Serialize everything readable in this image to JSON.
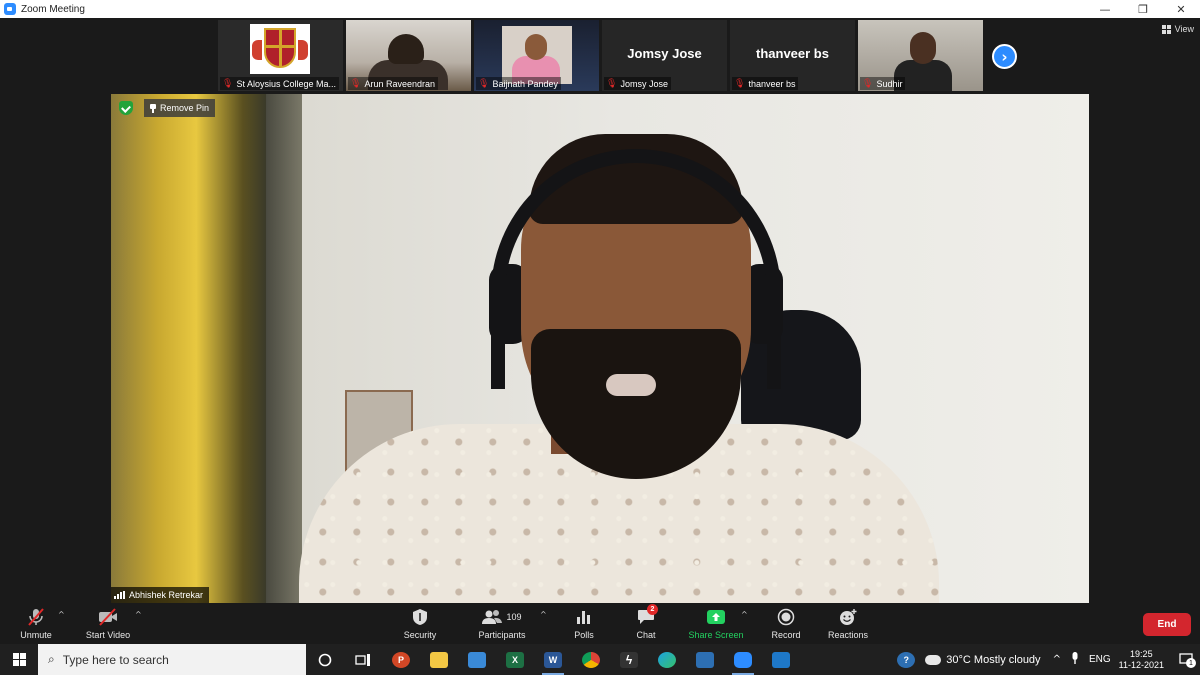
{
  "window": {
    "title": "Zoom Meeting",
    "minimize": "—",
    "restore": "❐",
    "close": "✕"
  },
  "view_label": "View",
  "participants_strip": [
    {
      "name": "St Aloysius College Ma..."
    },
    {
      "name": "Arun Raveendran"
    },
    {
      "name": "Baijnath Pandey"
    },
    {
      "name": "Jomsy Jose",
      "display_name": "Jomsy Jose"
    },
    {
      "name": "thanveer bs",
      "display_name": "thanveer bs"
    },
    {
      "name": "Sudhir"
    }
  ],
  "main_video": {
    "remove_pin": "Remove Pin",
    "speaker_name": "Abhishek Retrekar"
  },
  "toolbar": {
    "unmute": "Unmute",
    "start_video": "Start Video",
    "security": "Security",
    "participants": "Participants",
    "participants_count": "109",
    "polls": "Polls",
    "chat": "Chat",
    "chat_badge": "2",
    "share_screen": "Share Screen",
    "record": "Record",
    "reactions": "Reactions",
    "end": "End"
  },
  "taskbar": {
    "search_placeholder": "Type here to search",
    "weather": "30°C  Mostly cloudy",
    "language": "ENG",
    "time": "19:25",
    "date": "11-12-2021",
    "notification_count": "1",
    "apps": [
      {
        "icon": "task-view-icon"
      },
      {
        "icon": "powerpoint-icon",
        "color": "#d24726"
      },
      {
        "icon": "file-explorer-icon",
        "color": "#f2c744"
      },
      {
        "icon": "remote-desktop-icon",
        "color": "#3a8ad8"
      },
      {
        "icon": "excel-icon",
        "color": "#1d7044"
      },
      {
        "icon": "word-icon",
        "color": "#2b5797"
      },
      {
        "icon": "chrome-icon",
        "color": "#4caf50"
      },
      {
        "icon": "winamp-icon",
        "color": "#555555"
      },
      {
        "icon": "edge-icon",
        "color": "#1ba1e2"
      },
      {
        "icon": "photos-icon",
        "color": "#2d6fb3"
      },
      {
        "icon": "zoom-icon",
        "color": "#2d8cff"
      },
      {
        "icon": "media-player-icon",
        "color": "#1e78c8"
      }
    ]
  },
  "colors": {
    "accent": "#2d8cff",
    "end": "#d3262e",
    "share": "#23d160",
    "muted": "#e02828"
  }
}
